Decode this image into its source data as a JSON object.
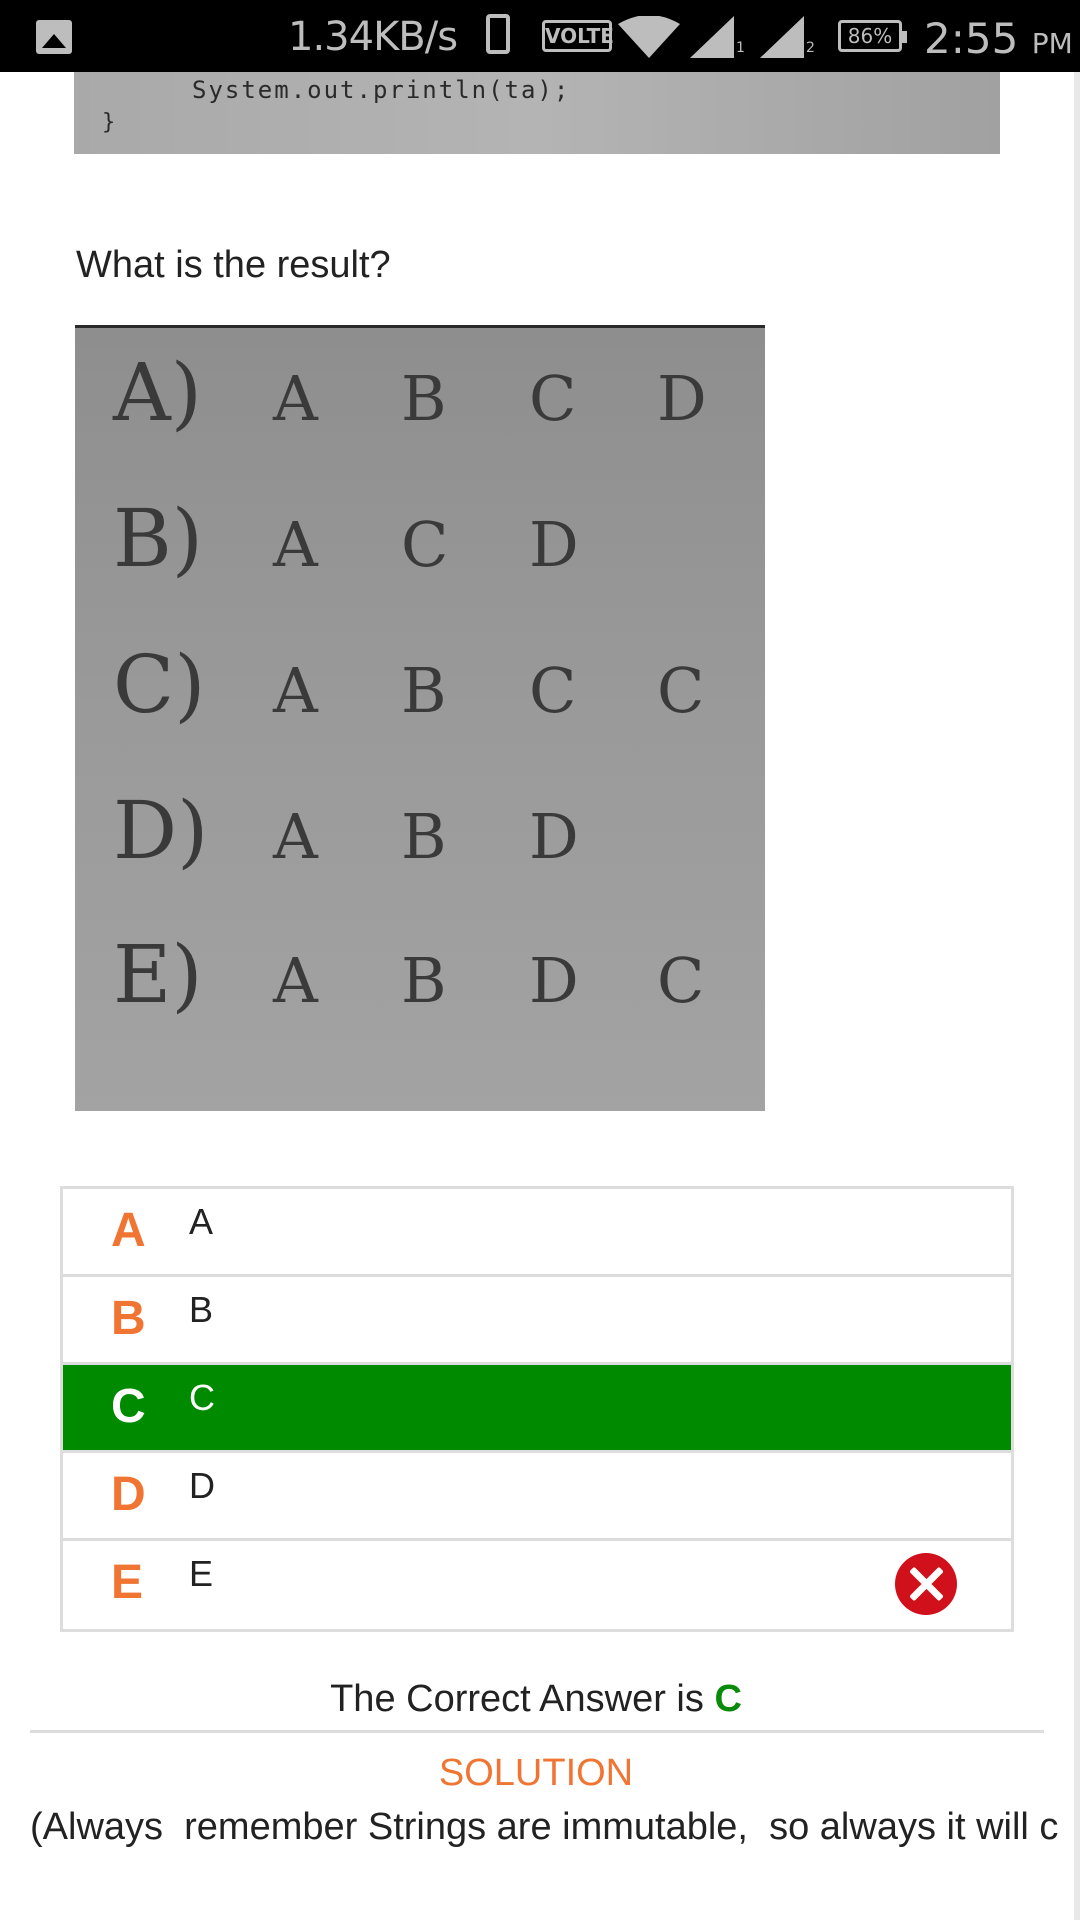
{
  "status_bar": {
    "speed": "1.34KB/s",
    "volte": "VOLTE",
    "sim1": "1",
    "sim2": "2",
    "battery": "86%",
    "time": "2:55",
    "ampm": "PM"
  },
  "code_image": {
    "line": "System.out.println(ta);",
    "brace": "}"
  },
  "question": "What is the result?",
  "options_image": {
    "rows": [
      {
        "key": "A)",
        "letters": [
          "A",
          "B",
          "C",
          "D"
        ]
      },
      {
        "key": "B)",
        "letters": [
          "A",
          "C",
          "D"
        ]
      },
      {
        "key": "C)",
        "letters": [
          "A",
          "B",
          "C",
          "C"
        ]
      },
      {
        "key": "D)",
        "letters": [
          "A",
          "B",
          "D"
        ]
      },
      {
        "key": "E)",
        "letters": [
          "A",
          "B",
          "D",
          "C"
        ]
      }
    ]
  },
  "answers": [
    {
      "letter": "A",
      "text": "A"
    },
    {
      "letter": "B",
      "text": "B"
    },
    {
      "letter": "C",
      "text": "C"
    },
    {
      "letter": "D",
      "text": "D"
    },
    {
      "letter": "E",
      "text": "E"
    }
  ],
  "selected_answer": "C",
  "wrong_marked_answer": "E",
  "correct_prefix": "The Correct Answer is",
  "correct_answer": "C",
  "solution_title": "SOLUTION",
  "solution_text": "(Always  remember Strings are immutable,  so always it will c",
  "colors": {
    "accent_orange": "#f07532",
    "correct_green": "#008a00",
    "wrong_red": "#d0111b"
  }
}
